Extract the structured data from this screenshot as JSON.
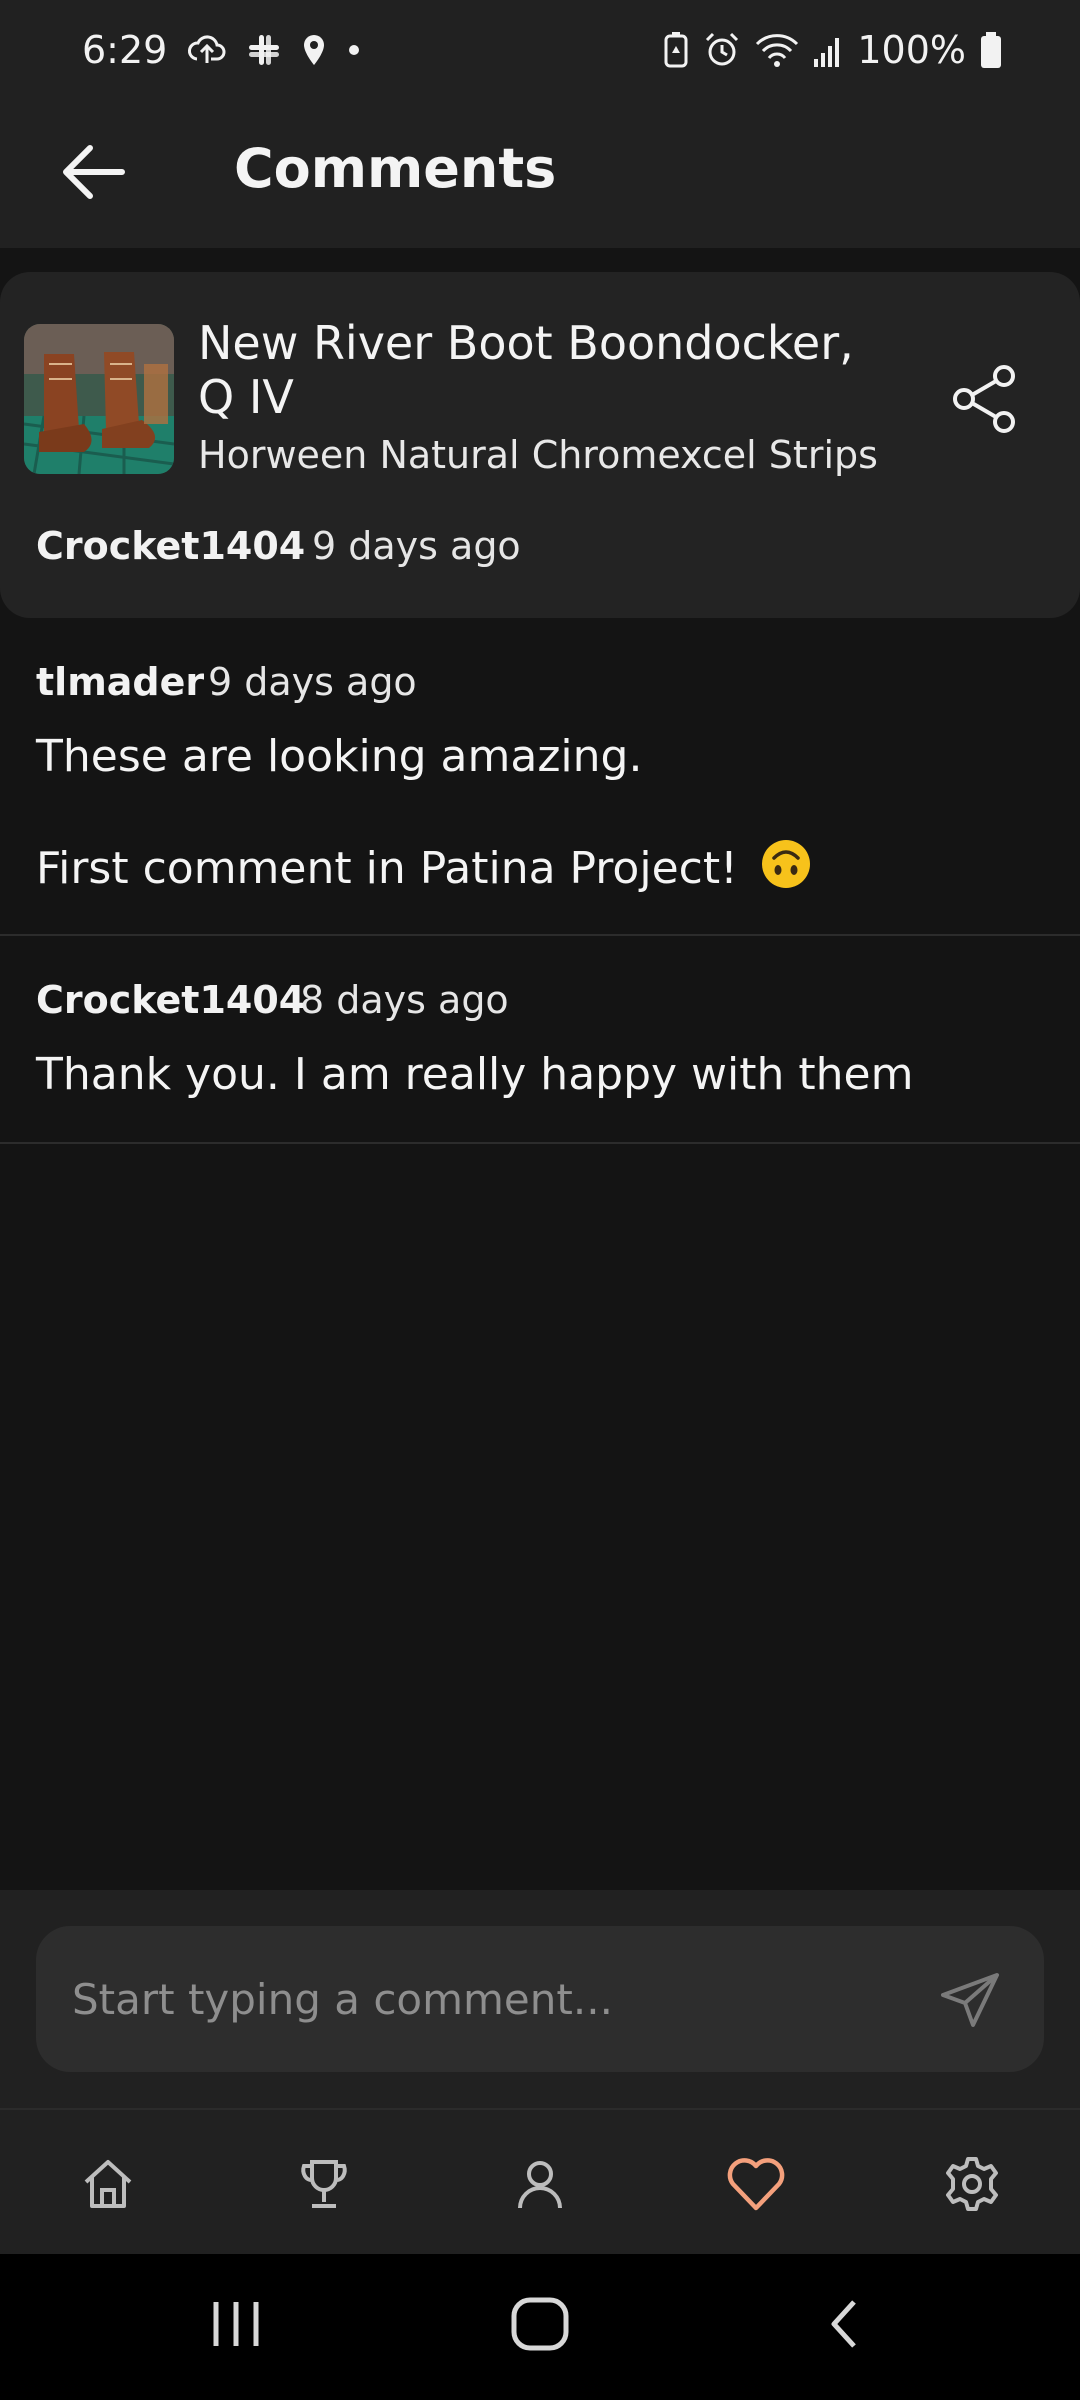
{
  "status_bar": {
    "time": "6:29",
    "battery": "100%",
    "left_icons": [
      "cloud-upload-icon",
      "slack-icon",
      "location-icon",
      "dot-icon"
    ],
    "right_icons": [
      "battery-saver-icon",
      "alarm-icon",
      "wifi-icon",
      "signal-icon",
      "battery-icon"
    ]
  },
  "app_bar": {
    "title": "Comments",
    "back_icon": "arrow-left-icon"
  },
  "post": {
    "title": "New River Boot Boondocker, Q IV",
    "subtitle": "Horween Natural Chromexcel Strips",
    "author": "Crocket1404",
    "time": "9 days ago",
    "share_icon": "share-icon"
  },
  "comments": [
    {
      "author": "tlmader",
      "time": "9 days ago",
      "line1": "These are looking amazing.",
      "line2": "First comment in Patina Project!",
      "emoji": "upside-down-face-emoji"
    },
    {
      "author": "Crocket1404",
      "time": "8 days ago",
      "line1": "Thank you. I am really happy with them"
    }
  ],
  "composer": {
    "placeholder": "Start typing a comment...",
    "send_icon": "send-icon"
  },
  "bottom_nav": {
    "items": [
      {
        "icon": "home-icon"
      },
      {
        "icon": "trophy-icon"
      },
      {
        "icon": "person-icon"
      },
      {
        "icon": "heart-icon"
      },
      {
        "icon": "gear-icon"
      }
    ],
    "active_color": "#f4a07c",
    "inactive_color": "#bdbdbd"
  },
  "system_nav": {
    "items": [
      "recents-icon",
      "home-circle-icon",
      "back-chevron-icon"
    ]
  }
}
